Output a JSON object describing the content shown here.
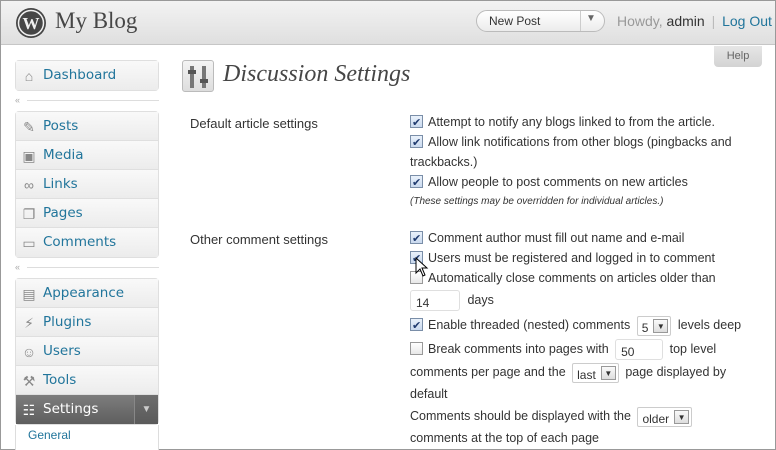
{
  "header": {
    "site_title": "My Blog",
    "new_post_label": "New Post",
    "howdy_prefix": "Howdy,",
    "username": "admin",
    "separator": "|",
    "logout_label": "Log Out"
  },
  "help_label": "Help",
  "sidebar": {
    "group1": [
      {
        "label": "Dashboard",
        "icon": "home-icon"
      }
    ],
    "group2": [
      {
        "label": "Posts",
        "icon": "pushpin-icon"
      },
      {
        "label": "Media",
        "icon": "media-icon"
      },
      {
        "label": "Links",
        "icon": "link-icon"
      },
      {
        "label": "Pages",
        "icon": "pages-icon"
      },
      {
        "label": "Comments",
        "icon": "comment-icon"
      }
    ],
    "group3": [
      {
        "label": "Appearance",
        "icon": "appearance-icon"
      },
      {
        "label": "Plugins",
        "icon": "plugin-icon"
      },
      {
        "label": "Users",
        "icon": "users-icon"
      },
      {
        "label": "Tools",
        "icon": "tools-icon"
      },
      {
        "label": "Settings",
        "icon": "settings-icon",
        "active": true
      }
    ],
    "settings_submenu": [
      "General"
    ]
  },
  "page": {
    "title": "Discussion Settings",
    "default_section": {
      "label": "Default article settings",
      "opt1": "Attempt to notify any blogs linked to from the article.",
      "opt2": "Allow link notifications from other blogs (pingbacks and",
      "opt2b": "trackbacks.)",
      "opt3": "Allow people to post comments on new articles",
      "note": "(These settings may be overridden for individual articles.)"
    },
    "other_section": {
      "label": "Other comment settings",
      "opt1": "Comment author must fill out name and e-mail",
      "opt2": "Users must be registered and logged in to comment",
      "opt3": "Automatically close comments on articles older than",
      "close_days_value": "14",
      "days_label": "days",
      "threaded_label": "Enable threaded (nested) comments",
      "threaded_depth": "5",
      "levels_deep_label": "levels deep",
      "paging_label": "Break comments into pages with",
      "per_page_value": "50",
      "top_level_label": "top level",
      "per_page_label": "comments per page and the",
      "page_default": "last",
      "page_displayed_label": "page displayed by",
      "default_label": "default",
      "order_prefix": "Comments should be displayed with the",
      "order_value": "older",
      "order_suffix": "comments at the top of each page"
    }
  }
}
